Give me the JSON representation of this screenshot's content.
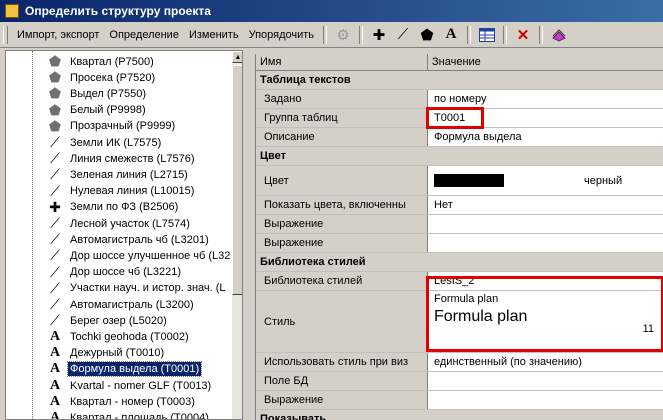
{
  "window": {
    "title": "Определить структуру проекта"
  },
  "toolbar": {
    "import_export": "Импорт, экспорт",
    "definition": "Определение",
    "change": "Изменить",
    "sort": "Упорядочить"
  },
  "tree": {
    "items": [
      {
        "label": "Квартал (P7500)",
        "icon": "polygon-icon",
        "glyph": "⬟"
      },
      {
        "label": "Просека (P7520)",
        "icon": "polygon-icon",
        "glyph": "⬟"
      },
      {
        "label": "Выдел (P7550)",
        "icon": "polygon-icon",
        "glyph": "⬟"
      },
      {
        "label": "Белый (P9998)",
        "icon": "polygon-icon",
        "glyph": "⬟"
      },
      {
        "label": "Прозрачный (P9999)",
        "icon": "polygon-icon",
        "glyph": "⬟"
      },
      {
        "label": "Земли ИК (L7575)",
        "icon": "line-icon",
        "glyph": "⟋"
      },
      {
        "label": "Линия смежеств (L7576)",
        "icon": "line-icon",
        "glyph": "⟋"
      },
      {
        "label": "Зеленая линия (L2715)",
        "icon": "line-icon",
        "glyph": "⟋"
      },
      {
        "label": "Нулевая линия (L10015)",
        "icon": "line-icon",
        "glyph": "⟋"
      },
      {
        "label": "Земли по ФЗ (B2506)",
        "icon": "point-icon",
        "glyph": "✚"
      },
      {
        "label": "Лесной участок (L7574)",
        "icon": "line-icon",
        "glyph": "⟋"
      },
      {
        "label": "Автомагистраль чб (L3201)",
        "icon": "line-icon",
        "glyph": "⟋"
      },
      {
        "label": "Дор шоссе улучшенное чб (L32",
        "icon": "line-icon",
        "glyph": "⟋"
      },
      {
        "label": "Дор шоссе чб (L3221)",
        "icon": "line-icon",
        "glyph": "⟋"
      },
      {
        "label": "Участки науч. и истор. знач. (L",
        "icon": "line-icon",
        "glyph": "⟋"
      },
      {
        "label": "Автомагистраль (L3200)",
        "icon": "line-icon",
        "glyph": "⟋"
      },
      {
        "label": "Берег озер (L5020)",
        "icon": "line-icon",
        "glyph": "⟋"
      },
      {
        "label": "Tochki geohoda (T0002)",
        "icon": "text-icon",
        "glyph": "A"
      },
      {
        "label": "Дежурный (T0010)",
        "icon": "text-icon",
        "glyph": "A"
      },
      {
        "label": "Формула выдела (T0001)",
        "icon": "text-icon",
        "glyph": "A",
        "selected": true
      },
      {
        "label": "Kvartal - nomer GLF (T0013)",
        "icon": "text-icon",
        "glyph": "A"
      },
      {
        "label": "Квартал - номер (T0003)",
        "icon": "text-icon",
        "glyph": "A"
      },
      {
        "label": "Квартал - площадь (T0004)",
        "icon": "text-icon",
        "glyph": "A"
      }
    ]
  },
  "grid": {
    "headers": {
      "name": "Имя",
      "value": "Значение"
    },
    "sections": {
      "texts_table": "Таблица текстов",
      "color": "Цвет",
      "style_library": "Библиотека стилей",
      "show": "Показывать"
    },
    "rows": {
      "set": {
        "name": "Задано",
        "value": "по номеру"
      },
      "table_group": {
        "name": "Группа таблиц",
        "value": "T0001"
      },
      "description": {
        "name": "Описание",
        "value": "Формула выдела"
      },
      "color": {
        "name": "Цвет",
        "value": "черный",
        "swatch": "#000000"
      },
      "show_colors": {
        "name": "Показать цвета, включенны",
        "value": "Нет"
      },
      "expr1": {
        "name": "Выражение",
        "value": ""
      },
      "expr2": {
        "name": "Выражение",
        "value": ""
      },
      "library": {
        "name": "Библиотека стилей",
        "value": "LesIS_2"
      },
      "style": {
        "name": "Стиль",
        "preview_small": "Formula plan",
        "preview_big": "Formula plan",
        "size": "11"
      },
      "use_style": {
        "name": "Использовать стиль при виз",
        "value": "единственный (по значению)"
      },
      "db_field": {
        "name": "Поле БД",
        "value": ""
      },
      "expr3": {
        "name": "Выражение",
        "value": ""
      }
    }
  },
  "colors": {
    "highlight": "#e00000",
    "selection": "#0a246a",
    "titlebar": "#0a246a"
  }
}
